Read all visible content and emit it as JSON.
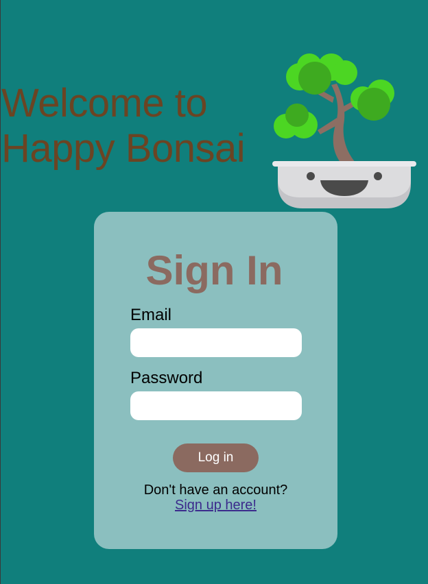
{
  "hero": {
    "title_line1": "Welcome to",
    "title_line2": "Happy Bonsai"
  },
  "logo": {
    "icon": "bonsai-tree-pot-icon"
  },
  "signin": {
    "title": "Sign In",
    "email_label": "Email",
    "email_value": "",
    "password_label": "Password",
    "password_value": "",
    "login_label": "Log in",
    "signup_prompt": "Don't have an account?",
    "signup_link": "Sign up here!"
  },
  "colors": {
    "background": "#107f7c",
    "card": "#8bbfbf",
    "title_brown": "#6b4423",
    "accent": "#8b6a60",
    "link": "#3b2a8c"
  }
}
